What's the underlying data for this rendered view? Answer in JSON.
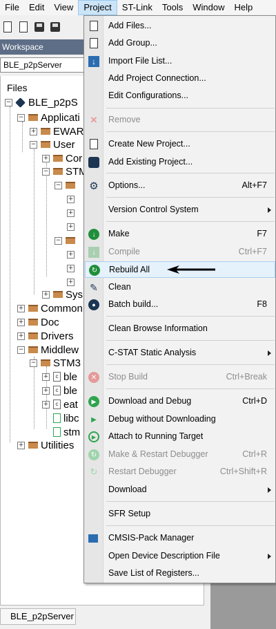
{
  "menubar": {
    "items": [
      "File",
      "Edit",
      "View",
      "Project",
      "ST-Link",
      "Tools",
      "Window",
      "Help"
    ],
    "active": "Project"
  },
  "toolbar": {
    "icons": [
      "new-file-icon",
      "new-workspace-icon",
      "save-icon",
      "save-all-icon"
    ]
  },
  "workspace": {
    "header": "Workspace",
    "selected_config": "BLE_p2pServer",
    "files_label": "Files",
    "tree": [
      {
        "label": "BLE_p2pS",
        "icon": "project-icon"
      },
      {
        "label": "Applicati",
        "icon": "folder-icon"
      },
      {
        "label": "EWAR",
        "icon": "folder-icon"
      },
      {
        "label": "User",
        "icon": "folder-icon"
      },
      {
        "label": "Cor",
        "icon": "folder-icon"
      },
      {
        "label": "STM",
        "icon": "folder-icon"
      },
      {
        "label": "Sys",
        "icon": "folder-icon"
      },
      {
        "label": "Common",
        "icon": "folder-icon"
      },
      {
        "label": "Doc",
        "icon": "folder-icon"
      },
      {
        "label": "Drivers",
        "icon": "folder-icon"
      },
      {
        "label": "Middlew",
        "icon": "folder-icon"
      },
      {
        "label": "STM3",
        "icon": "folder-icon"
      },
      {
        "label": "ble",
        "icon": "c-file-icon"
      },
      {
        "label": "ble",
        "icon": "c-file-icon"
      },
      {
        "label": "eat",
        "icon": "c-file-icon"
      },
      {
        "label": "libc",
        "icon": "h-file-icon"
      },
      {
        "label": "stm",
        "icon": "h-file-icon"
      },
      {
        "label": "Utilities",
        "icon": "folder-icon"
      }
    ],
    "bottom_tab": "BLE_p2pServer"
  },
  "project_menu": {
    "items": [
      {
        "label": "Add Files...",
        "shortcut": "",
        "enabled": true,
        "icon": "add-files-icon"
      },
      {
        "label": "Add Group...",
        "shortcut": "",
        "enabled": true,
        "icon": "add-group-icon"
      },
      {
        "label": "Import File List...",
        "shortcut": "",
        "enabled": true,
        "icon": "import-icon"
      },
      {
        "label": "Add Project Connection...",
        "shortcut": "",
        "enabled": true,
        "icon": ""
      },
      {
        "label": "Edit Configurations...",
        "shortcut": "",
        "enabled": true,
        "icon": ""
      },
      {
        "label": "Remove",
        "shortcut": "",
        "enabled": false,
        "icon": "remove-icon"
      },
      {
        "label": "Create New Project...",
        "shortcut": "",
        "enabled": true,
        "icon": "create-project-icon"
      },
      {
        "label": "Add Existing Project...",
        "shortcut": "",
        "enabled": true,
        "icon": "add-existing-project-icon"
      },
      {
        "label": "Options...",
        "shortcut": "Alt+F7",
        "enabled": true,
        "icon": "gear-icon"
      },
      {
        "label": "Version Control System",
        "shortcut": "",
        "enabled": true,
        "icon": "",
        "submenu": true
      },
      {
        "label": "Make",
        "shortcut": "F7",
        "enabled": true,
        "icon": "make-icon"
      },
      {
        "label": "Compile",
        "shortcut": "Ctrl+F7",
        "enabled": false,
        "icon": "compile-icon"
      },
      {
        "label": "Rebuild All",
        "shortcut": "",
        "enabled": true,
        "icon": "rebuild-icon",
        "highlight": true
      },
      {
        "label": "Clean",
        "shortcut": "",
        "enabled": true,
        "icon": "clean-icon"
      },
      {
        "label": "Batch build...",
        "shortcut": "F8",
        "enabled": true,
        "icon": "batch-build-icon"
      },
      {
        "label": "Clean Browse Information",
        "shortcut": "",
        "enabled": true,
        "icon": ""
      },
      {
        "label": "C-STAT Static Analysis",
        "shortcut": "",
        "enabled": true,
        "icon": "",
        "submenu": true
      },
      {
        "label": "Stop Build",
        "shortcut": "Ctrl+Break",
        "enabled": false,
        "icon": "stop-icon"
      },
      {
        "label": "Download and Debug",
        "shortcut": "Ctrl+D",
        "enabled": true,
        "icon": "play-icon"
      },
      {
        "label": "Debug without Downloading",
        "shortcut": "",
        "enabled": true,
        "icon": "play-small-icon"
      },
      {
        "label": "Attach to Running Target",
        "shortcut": "",
        "enabled": true,
        "icon": "attach-icon"
      },
      {
        "label": "Make & Restart Debugger",
        "shortcut": "Ctrl+R",
        "enabled": false,
        "icon": "restart-icon"
      },
      {
        "label": "Restart Debugger",
        "shortcut": "Ctrl+Shift+R",
        "enabled": false,
        "icon": "restart-small-icon"
      },
      {
        "label": "Download",
        "shortcut": "",
        "enabled": true,
        "icon": "",
        "submenu": true
      },
      {
        "label": "SFR Setup",
        "shortcut": "",
        "enabled": true,
        "icon": ""
      },
      {
        "label": "CMSIS-Pack Manager",
        "shortcut": "",
        "enabled": true,
        "icon": "cmsis-pack-icon"
      },
      {
        "label": "Open Device Description File",
        "shortcut": "",
        "enabled": true,
        "icon": "",
        "submenu": true
      },
      {
        "label": "Save List of Registers...",
        "shortcut": "",
        "enabled": true,
        "icon": ""
      }
    ]
  },
  "colors": {
    "workspace_header": "#5e6e86",
    "menu_highlight": "#e5f1fb",
    "folder": "#c98a4b",
    "green_icon": "#2ea44f",
    "red_icon": "#e05a5a"
  }
}
